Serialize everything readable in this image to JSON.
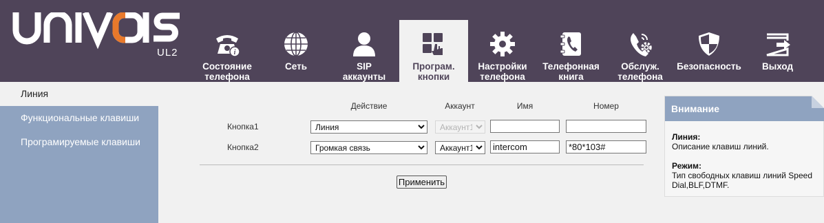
{
  "brand": {
    "logo_text": "UNIVOIS",
    "model": "UL2"
  },
  "tabs": [
    {
      "id": "status",
      "label": "Состояние телефона",
      "icon": "phone-info-icon"
    },
    {
      "id": "network",
      "label": "Сеть",
      "icon": "globe-icon"
    },
    {
      "id": "sip",
      "label": "SIP аккаунты",
      "icon": "user-icon"
    },
    {
      "id": "prog",
      "label": "Програм. кнопки",
      "icon": "keypad-icon",
      "active": true
    },
    {
      "id": "settings",
      "label": "Настройки телефона",
      "icon": "gear-icon"
    },
    {
      "id": "phonebook",
      "label": "Телефонная книга",
      "icon": "phonebook-icon"
    },
    {
      "id": "maint",
      "label": "Обслуж. телефона",
      "icon": "phone-gear-icon"
    },
    {
      "id": "security",
      "label": "Безопасность",
      "icon": "shield-icon"
    },
    {
      "id": "logout",
      "label": "Выход",
      "icon": "logout-icon"
    }
  ],
  "sidebar": {
    "items": [
      {
        "label": "Линия",
        "active": true
      },
      {
        "label": "Функциональные клавиши"
      },
      {
        "label": "Програмируемые клавиши"
      }
    ]
  },
  "table": {
    "headers": {
      "action": "Действие",
      "account": "Аккаунт",
      "name": "Имя",
      "number": "Номер"
    },
    "rows": [
      {
        "label": "Кнопка1",
        "action": "Линия",
        "account": "Аккаунт1",
        "account_disabled": true,
        "name": "",
        "number": ""
      },
      {
        "label": "Кнопка2",
        "action": "Громкая связь",
        "account": "Аккаунт1",
        "account_disabled": false,
        "name": "intercom",
        "number": "*80*103#"
      }
    ],
    "apply_label": "Применить"
  },
  "notice": {
    "title": "Внимание",
    "line_title": "Линия:",
    "line_text": "Описание клавиш линий.",
    "mode_title": "Режим:",
    "mode_text": "Тип свободных клавиш линий Speed Dial,BLF,DTMF."
  },
  "colors": {
    "header_bg": "#4f4459",
    "accent_blue": "#8fa3c0",
    "logo_accent": "#e8792b",
    "page_bg": "#f1f1f1"
  }
}
